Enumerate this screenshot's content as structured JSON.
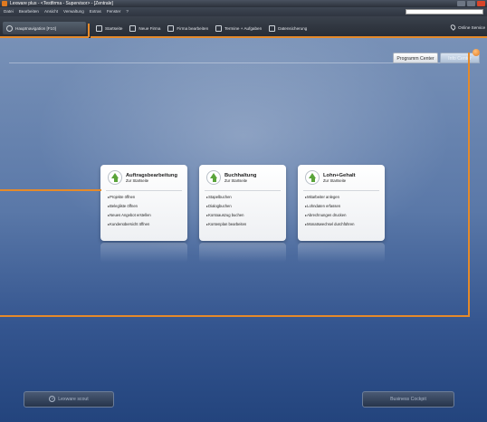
{
  "window": {
    "title": "Lexware plus - <Testfirma - Supervisor> - [Zentrale]"
  },
  "menubar": {
    "items": [
      "Datei",
      "Bearbeiten",
      "Ansicht",
      "Verwaltung",
      "Extras",
      "Fenster",
      "?"
    ]
  },
  "toolbar": {
    "nav_label": "Hauptnavigation [F10]",
    "tools": [
      {
        "label": "Startseite",
        "icon": "home-icon"
      },
      {
        "label": "Neue Firma",
        "icon": "new-company-icon"
      },
      {
        "label": "Firma bearbeiten",
        "icon": "edit-company-icon"
      },
      {
        "label": "Termine + Aufgaben",
        "icon": "calendar-icon"
      },
      {
        "label": "Datensicherung",
        "icon": "backup-icon"
      }
    ],
    "online_label": "Online Service"
  },
  "switcher": {
    "programs_label": "Programm Center",
    "info_label": "Info Center"
  },
  "cards": [
    {
      "title": "Auftragsbearbeitung",
      "subtitle": "Zur Startseite",
      "links": [
        "Projekte öffnen",
        "Belegliste öffnen",
        "Neues Angebot erstellen",
        "Kundenübersicht öffnen"
      ]
    },
    {
      "title": "Buchhaltung",
      "subtitle": "Zur Startseite",
      "links": [
        "Stapelbuchen",
        "Dialogbuchen",
        "Kontoauszug buchen",
        "Kontenplan bearbeiten"
      ]
    },
    {
      "title": "Lohn+Gehalt",
      "subtitle": "Zur Startseite",
      "links": [
        "Mitarbeiter anlegen",
        "Lohndaten erfassen",
        "Abrechnungen drucken",
        "Monatswechsel durchführen"
      ]
    }
  ],
  "bottom": {
    "scout_label": "Lexware scout",
    "cockpit_label": "Business Cockpit"
  },
  "colors": {
    "accent_orange": "#e58a2a",
    "background_blue": "#5a78a8",
    "arrow_green": "#5aa43a"
  }
}
